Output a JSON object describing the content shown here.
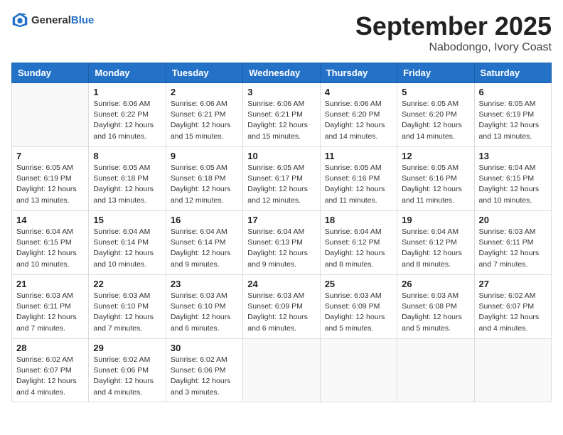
{
  "header": {
    "logo_general": "General",
    "logo_blue": "Blue",
    "month_title": "September 2025",
    "location": "Nabodongo, Ivory Coast"
  },
  "days_of_week": [
    "Sunday",
    "Monday",
    "Tuesday",
    "Wednesday",
    "Thursday",
    "Friday",
    "Saturday"
  ],
  "weeks": [
    [
      {
        "day": "",
        "info": ""
      },
      {
        "day": "1",
        "info": "Sunrise: 6:06 AM\nSunset: 6:22 PM\nDaylight: 12 hours\nand 16 minutes."
      },
      {
        "day": "2",
        "info": "Sunrise: 6:06 AM\nSunset: 6:21 PM\nDaylight: 12 hours\nand 15 minutes."
      },
      {
        "day": "3",
        "info": "Sunrise: 6:06 AM\nSunset: 6:21 PM\nDaylight: 12 hours\nand 15 minutes."
      },
      {
        "day": "4",
        "info": "Sunrise: 6:06 AM\nSunset: 6:20 PM\nDaylight: 12 hours\nand 14 minutes."
      },
      {
        "day": "5",
        "info": "Sunrise: 6:05 AM\nSunset: 6:20 PM\nDaylight: 12 hours\nand 14 minutes."
      },
      {
        "day": "6",
        "info": "Sunrise: 6:05 AM\nSunset: 6:19 PM\nDaylight: 12 hours\nand 13 minutes."
      }
    ],
    [
      {
        "day": "7",
        "info": "Sunrise: 6:05 AM\nSunset: 6:19 PM\nDaylight: 12 hours\nand 13 minutes."
      },
      {
        "day": "8",
        "info": "Sunrise: 6:05 AM\nSunset: 6:18 PM\nDaylight: 12 hours\nand 13 minutes."
      },
      {
        "day": "9",
        "info": "Sunrise: 6:05 AM\nSunset: 6:18 PM\nDaylight: 12 hours\nand 12 minutes."
      },
      {
        "day": "10",
        "info": "Sunrise: 6:05 AM\nSunset: 6:17 PM\nDaylight: 12 hours\nand 12 minutes."
      },
      {
        "day": "11",
        "info": "Sunrise: 6:05 AM\nSunset: 6:16 PM\nDaylight: 12 hours\nand 11 minutes."
      },
      {
        "day": "12",
        "info": "Sunrise: 6:05 AM\nSunset: 6:16 PM\nDaylight: 12 hours\nand 11 minutes."
      },
      {
        "day": "13",
        "info": "Sunrise: 6:04 AM\nSunset: 6:15 PM\nDaylight: 12 hours\nand 10 minutes."
      }
    ],
    [
      {
        "day": "14",
        "info": "Sunrise: 6:04 AM\nSunset: 6:15 PM\nDaylight: 12 hours\nand 10 minutes."
      },
      {
        "day": "15",
        "info": "Sunrise: 6:04 AM\nSunset: 6:14 PM\nDaylight: 12 hours\nand 10 minutes."
      },
      {
        "day": "16",
        "info": "Sunrise: 6:04 AM\nSunset: 6:14 PM\nDaylight: 12 hours\nand 9 minutes."
      },
      {
        "day": "17",
        "info": "Sunrise: 6:04 AM\nSunset: 6:13 PM\nDaylight: 12 hours\nand 9 minutes."
      },
      {
        "day": "18",
        "info": "Sunrise: 6:04 AM\nSunset: 6:12 PM\nDaylight: 12 hours\nand 8 minutes."
      },
      {
        "day": "19",
        "info": "Sunrise: 6:04 AM\nSunset: 6:12 PM\nDaylight: 12 hours\nand 8 minutes."
      },
      {
        "day": "20",
        "info": "Sunrise: 6:03 AM\nSunset: 6:11 PM\nDaylight: 12 hours\nand 7 minutes."
      }
    ],
    [
      {
        "day": "21",
        "info": "Sunrise: 6:03 AM\nSunset: 6:11 PM\nDaylight: 12 hours\nand 7 minutes."
      },
      {
        "day": "22",
        "info": "Sunrise: 6:03 AM\nSunset: 6:10 PM\nDaylight: 12 hours\nand 7 minutes."
      },
      {
        "day": "23",
        "info": "Sunrise: 6:03 AM\nSunset: 6:10 PM\nDaylight: 12 hours\nand 6 minutes."
      },
      {
        "day": "24",
        "info": "Sunrise: 6:03 AM\nSunset: 6:09 PM\nDaylight: 12 hours\nand 6 minutes."
      },
      {
        "day": "25",
        "info": "Sunrise: 6:03 AM\nSunset: 6:09 PM\nDaylight: 12 hours\nand 5 minutes."
      },
      {
        "day": "26",
        "info": "Sunrise: 6:03 AM\nSunset: 6:08 PM\nDaylight: 12 hours\nand 5 minutes."
      },
      {
        "day": "27",
        "info": "Sunrise: 6:02 AM\nSunset: 6:07 PM\nDaylight: 12 hours\nand 4 minutes."
      }
    ],
    [
      {
        "day": "28",
        "info": "Sunrise: 6:02 AM\nSunset: 6:07 PM\nDaylight: 12 hours\nand 4 minutes."
      },
      {
        "day": "29",
        "info": "Sunrise: 6:02 AM\nSunset: 6:06 PM\nDaylight: 12 hours\nand 4 minutes."
      },
      {
        "day": "30",
        "info": "Sunrise: 6:02 AM\nSunset: 6:06 PM\nDaylight: 12 hours\nand 3 minutes."
      },
      {
        "day": "",
        "info": ""
      },
      {
        "day": "",
        "info": ""
      },
      {
        "day": "",
        "info": ""
      },
      {
        "day": "",
        "info": ""
      }
    ]
  ]
}
